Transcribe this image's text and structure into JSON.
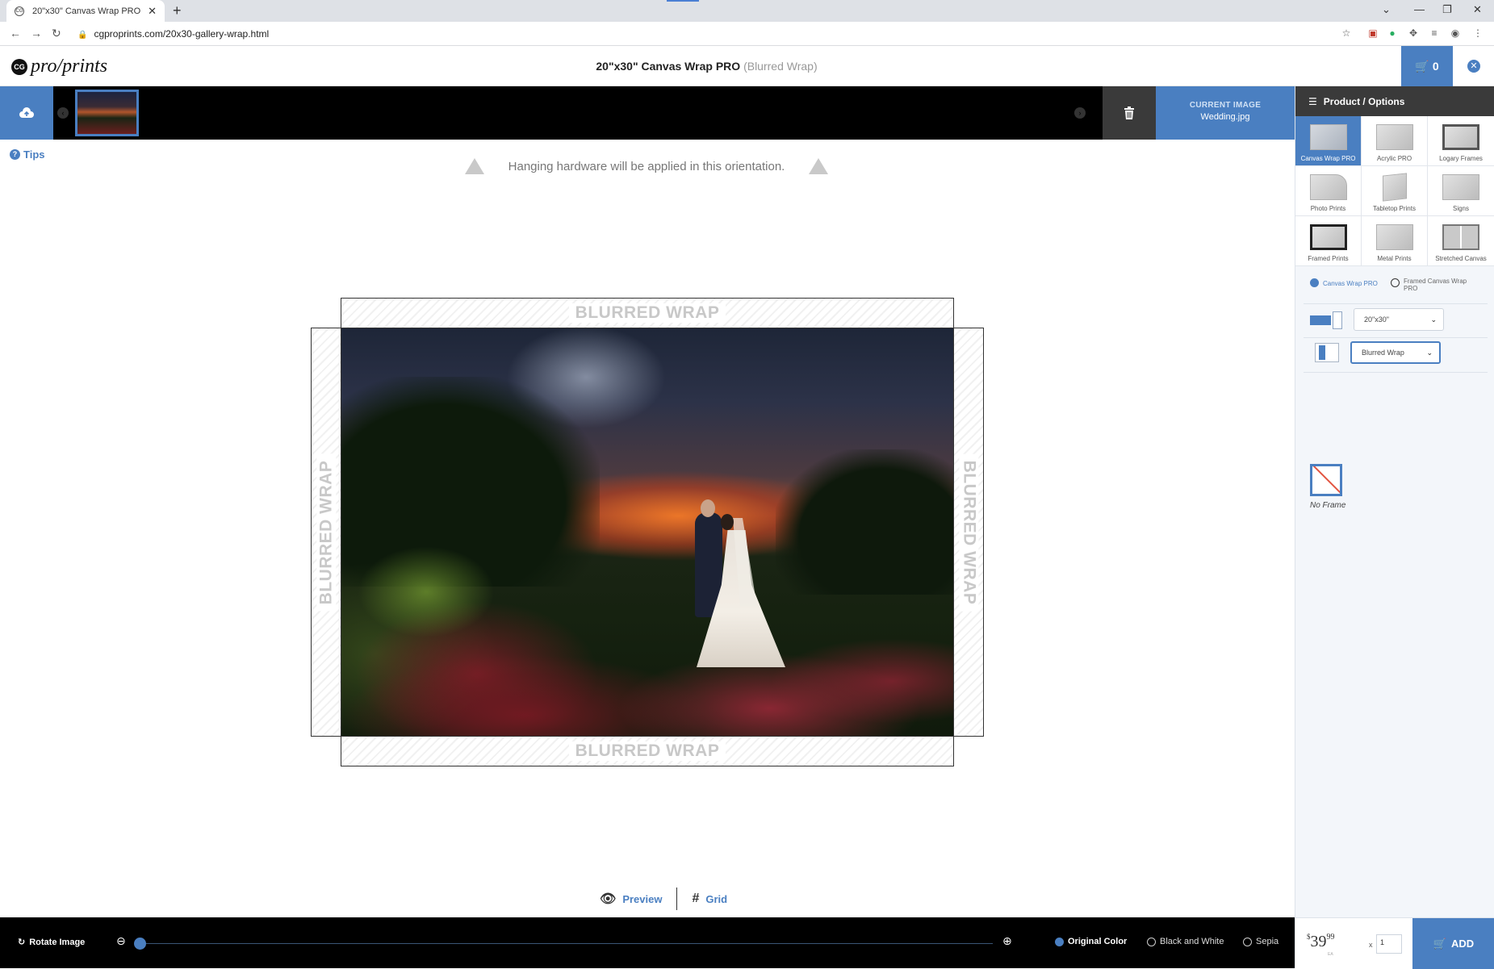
{
  "browser": {
    "tab_title": "20\"x30\" Canvas Wrap PRO",
    "url": "cgproprints.com/20x30-gallery-wrap.html"
  },
  "header": {
    "logo_text": "pro/prints",
    "logo_badge": "CG",
    "title": "20\"x30\" Canvas Wrap PRO",
    "subtitle": "(Blurred Wrap)",
    "cart_count": "0"
  },
  "strip": {
    "current_image_label": "CURRENT IMAGE",
    "current_image_name": "Wedding.jpg"
  },
  "tips_label": "Tips",
  "notice": "Hanging hardware will be applied in this orientation.",
  "canvas": {
    "wrap_top": "BLURRED WRAP",
    "wrap_bottom": "BLURRED WRAP",
    "wrap_left": "BLURRED WRAP",
    "wrap_right": "BLURRED WRAP"
  },
  "view": {
    "preview_label": "Preview",
    "grid_label": "Grid"
  },
  "toolbar": {
    "rotate_label": "Rotate Image",
    "zoom_level": 0,
    "color_options": [
      {
        "label": "Original Color",
        "selected": true
      },
      {
        "label": "Black and White",
        "selected": false
      },
      {
        "label": "Sepia",
        "selected": false
      }
    ]
  },
  "panel": {
    "title": "Product / Options",
    "products": [
      {
        "label": "Canvas Wrap PRO",
        "selected": true
      },
      {
        "label": "Acrylic PRO",
        "selected": false
      },
      {
        "label": "Logary Frames",
        "selected": false
      },
      {
        "label": "Photo Prints",
        "selected": false
      },
      {
        "label": "Tabletop Prints",
        "selected": false
      },
      {
        "label": "Signs",
        "selected": false
      },
      {
        "label": "Framed Prints",
        "selected": false
      },
      {
        "label": "Metal Prints",
        "selected": false
      },
      {
        "label": "Stretched Canvas",
        "selected": false
      }
    ],
    "variants": [
      {
        "label": "Canvas Wrap PRO",
        "selected": true
      },
      {
        "label": "Framed Canvas Wrap PRO",
        "selected": false
      }
    ],
    "size_value": "20\"x30\"",
    "edge_value": "Blurred Wrap",
    "frame_label": "No Frame",
    "price_dollar": "$",
    "price_main": "39",
    "price_cents": "99",
    "price_note": "EA",
    "qty_x": "x",
    "quantity": "1",
    "add_label": "ADD"
  },
  "colors": {
    "accent": "#4a7fc1",
    "dark_bar": "#000000"
  }
}
